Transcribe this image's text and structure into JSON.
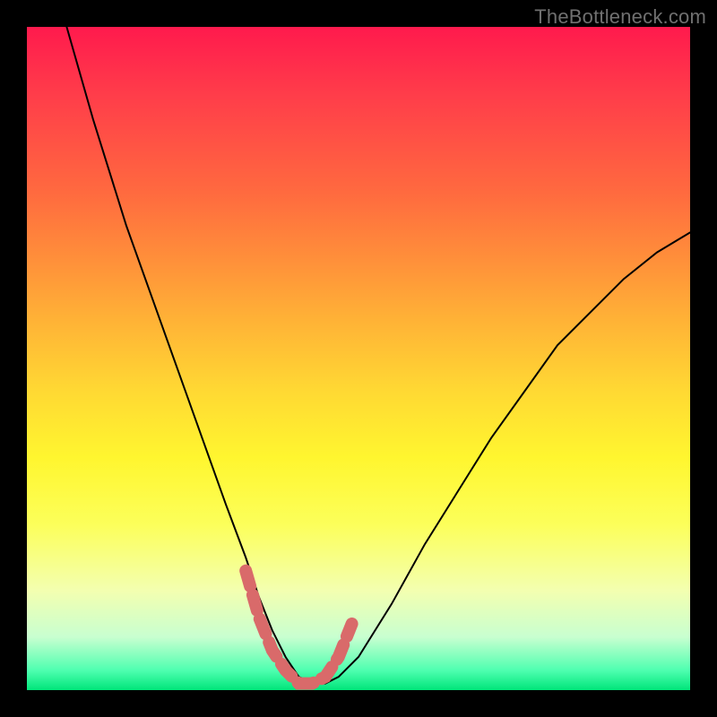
{
  "watermark": "TheBottleneck.com",
  "chart_data": {
    "type": "line",
    "title": "",
    "xlabel": "",
    "ylabel": "",
    "xlim": [
      0,
      100
    ],
    "ylim": [
      0,
      100
    ],
    "series": [
      {
        "name": "bottleneck-curve",
        "x": [
          6,
          10,
          15,
          20,
          25,
          30,
          33,
          35,
          37,
          39,
          41,
          43,
          45,
          47,
          50,
          55,
          60,
          65,
          70,
          75,
          80,
          85,
          90,
          95,
          100
        ],
        "values": [
          100,
          86,
          70,
          56,
          42,
          28,
          20,
          14,
          9,
          5,
          2,
          1,
          1,
          2,
          5,
          13,
          22,
          30,
          38,
          45,
          52,
          57,
          62,
          66,
          69
        ]
      }
    ],
    "highlight": {
      "name": "minimum-band",
      "color": "#d96a6a",
      "x": [
        33,
        35,
        37,
        39,
        41,
        43,
        45,
        47,
        49
      ],
      "values": [
        18,
        11,
        6,
        3,
        1,
        1,
        2,
        5,
        10
      ]
    }
  }
}
